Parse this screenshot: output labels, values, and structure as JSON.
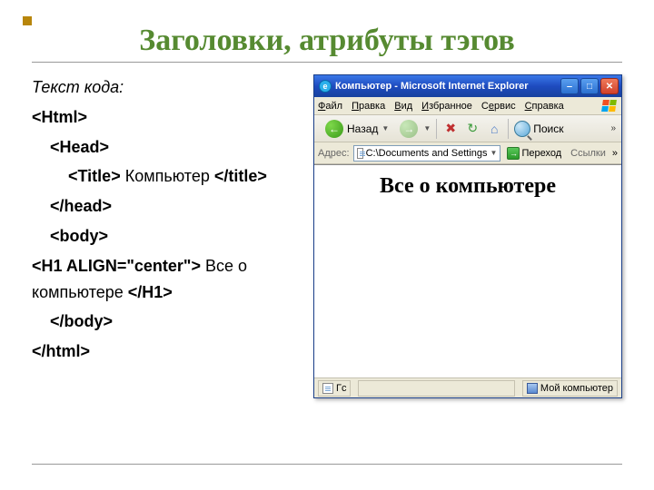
{
  "slide": {
    "title": "Заголовки, атрибуты тэгов",
    "code_label": "Текст кода:",
    "code": {
      "l1": "<Html>",
      "l2": "<Head>",
      "l3a": "<Title>",
      "l3b": " Компьютер ",
      "l3c": "</title>",
      "l4": "</head>",
      "l5": "<body>",
      "l6a": "<H1 ALIGN=\"center\">",
      "l6b": " Все о компьютере ",
      "l6c": "</H1>",
      "l7": "</body>",
      "l8": "</html>"
    }
  },
  "browser": {
    "title": "Компьютер - Microsoft Internet Explorer",
    "menu": {
      "file": "Файл",
      "edit": "Правка",
      "view": "Вид",
      "favorites": "Избранное",
      "tools": "Сервис",
      "help": "Справка"
    },
    "toolbar": {
      "back": "Назад",
      "search": "Поиск"
    },
    "address": {
      "label": "Адрес:",
      "value": "C:\\Documents and Settings",
      "go": "Переход",
      "links": "Ссылки"
    },
    "page": {
      "heading": "Все о компьютере"
    },
    "status": {
      "left": "Гс",
      "zone": "Мой компьютер"
    }
  }
}
